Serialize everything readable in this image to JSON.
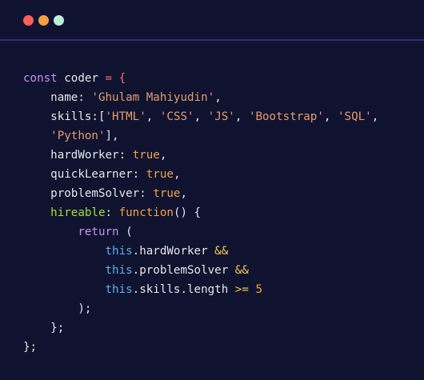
{
  "window": {
    "controls": [
      "close",
      "minimize",
      "maximize"
    ],
    "colors": {
      "close": "#ff5f57",
      "minimize": "#f5a142",
      "maximize": "#b8f2d8",
      "background": "#0f1330",
      "divider": "#2c2f78"
    }
  },
  "syntax_colors": {
    "keyword": "#c792ea",
    "plain": "#e6e6e6",
    "punct": "#f07178",
    "string": "#e79b6b",
    "value": "#f5a142",
    "method": "#a6e22e",
    "func": "#f2c94c",
    "this": "#5fb0e6"
  },
  "code_lines": [
    [
      {
        "t": "const",
        "c": "keyword"
      },
      {
        "t": " coder ",
        "c": "plain"
      },
      {
        "t": "= {",
        "c": "punct"
      }
    ],
    [
      {
        "t": "    name",
        "c": "plain"
      },
      {
        "t": ": ",
        "c": "plain"
      },
      {
        "t": "'Ghulam Mahiyudin'",
        "c": "string"
      },
      {
        "t": ",",
        "c": "plain"
      }
    ],
    [
      {
        "t": "    skills",
        "c": "plain"
      },
      {
        "t": ":[",
        "c": "plain"
      },
      {
        "t": "'HTML'",
        "c": "string"
      },
      {
        "t": ", ",
        "c": "plain"
      },
      {
        "t": "'CSS'",
        "c": "string"
      },
      {
        "t": ", ",
        "c": "plain"
      },
      {
        "t": "'JS'",
        "c": "string"
      },
      {
        "t": ", ",
        "c": "plain"
      },
      {
        "t": "'Bootstrap'",
        "c": "string"
      },
      {
        "t": ", ",
        "c": "plain"
      },
      {
        "t": "'SQL'",
        "c": "string"
      },
      {
        "t": ",",
        "c": "plain"
      }
    ],
    [
      {
        "t": "    ",
        "c": "plain"
      },
      {
        "t": "'Python'",
        "c": "string"
      },
      {
        "t": "],",
        "c": "plain"
      }
    ],
    [
      {
        "t": "    hardWorker",
        "c": "plain"
      },
      {
        "t": ": ",
        "c": "plain"
      },
      {
        "t": "true",
        "c": "value"
      },
      {
        "t": ",",
        "c": "plain"
      }
    ],
    [
      {
        "t": "    quickLearner",
        "c": "plain"
      },
      {
        "t": ": ",
        "c": "plain"
      },
      {
        "t": "true",
        "c": "value"
      },
      {
        "t": ",",
        "c": "plain"
      }
    ],
    [
      {
        "t": "    problemSolver",
        "c": "plain"
      },
      {
        "t": ": ",
        "c": "plain"
      },
      {
        "t": "true",
        "c": "value"
      },
      {
        "t": ",",
        "c": "plain"
      }
    ],
    [
      {
        "t": "    hireable",
        "c": "method"
      },
      {
        "t": ": ",
        "c": "plain"
      },
      {
        "t": "function",
        "c": "value"
      },
      {
        "t": "() {",
        "c": "plain"
      }
    ],
    [
      {
        "t": "        return",
        "c": "keyword"
      },
      {
        "t": " (",
        "c": "plain"
      }
    ],
    [
      {
        "t": "            this",
        "c": "this"
      },
      {
        "t": ".hardWorker ",
        "c": "plain"
      },
      {
        "t": "&&",
        "c": "func"
      }
    ],
    [
      {
        "t": "            this",
        "c": "this"
      },
      {
        "t": ".problemSolver ",
        "c": "plain"
      },
      {
        "t": "&&",
        "c": "func"
      }
    ],
    [
      {
        "t": "            this",
        "c": "this"
      },
      {
        "t": ".skills.length ",
        "c": "plain"
      },
      {
        "t": ">=",
        "c": "func"
      },
      {
        "t": " ",
        "c": "plain"
      },
      {
        "t": "5",
        "c": "value"
      }
    ],
    [
      {
        "t": "        );",
        "c": "plain"
      }
    ],
    [
      {
        "t": "    };",
        "c": "plain"
      }
    ],
    [
      {
        "t": "};",
        "c": "plain"
      }
    ]
  ]
}
